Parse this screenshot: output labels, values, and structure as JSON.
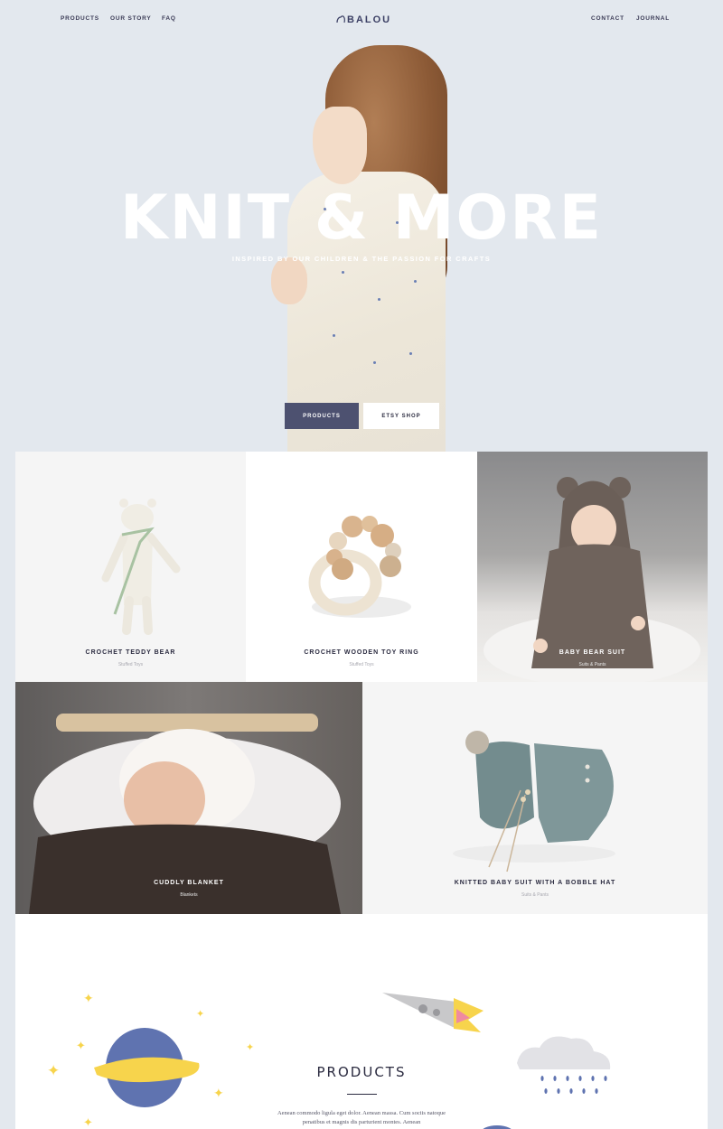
{
  "nav": {
    "left": [
      "PRODUCTS",
      "OUR STORY",
      "FAQ"
    ],
    "right": [
      "CONTACT",
      "JOURNAL"
    ],
    "brand": "BALOU"
  },
  "hero": {
    "title": "KNIT & MORE",
    "subtitle": "INSPIRED BY OUR CHILDREN & THE PASSION FOR CRAFTS",
    "primary_button": "PRODUCTS",
    "secondary_button": "ETSY SHOP"
  },
  "products": [
    {
      "title": "CROCHET TEDDY BEAR",
      "category": "Stuffed Toys"
    },
    {
      "title": "CROCHET WOODEN TOY RING",
      "category": "Stuffed Toys"
    },
    {
      "title": "BABY BEAR SUIT",
      "category": "Suits & Pants"
    },
    {
      "title": "CUDDLY BLANKET",
      "category": "Blankets"
    },
    {
      "title": "KNITTED BABY SUIT WITH A BOBBLE HAT",
      "category": "Suits & Pants"
    }
  ],
  "products_section": {
    "title": "PRODUCTS",
    "text": "Aenean commodo ligula eget dolor. Aenean massa. Cum sociis natoque penatibus et magnis dis parturient montes. Aenean"
  },
  "colors": {
    "background": "#e3e8ee",
    "accent": "#4d5170",
    "planet": "#5f73b0",
    "star": "#f7d44c"
  }
}
